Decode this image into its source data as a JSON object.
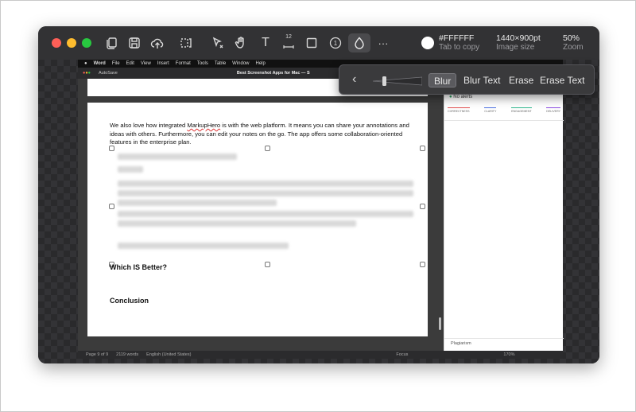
{
  "toolbar": {
    "color_hex": "#FFFFFF",
    "color_hint": "Tab to copy",
    "image_size_value": "1440×900pt",
    "image_size_label": "Image size",
    "zoom_value": "50%",
    "zoom_label": "Zoom",
    "more_label": "···",
    "text_tool": "T",
    "step_tool": "1",
    "size_tool_label": "12"
  },
  "colors": {
    "light_close": "#fe5f57",
    "light_minimize": "#febc2e",
    "light_zoom": "#28c840"
  },
  "blur_popup": {
    "options": [
      "Blur",
      "Blur Text",
      "Erase",
      "Erase Text"
    ],
    "selected": "Blur"
  },
  "screenshot": {
    "menubar": [
      "Word",
      "File",
      "Edit",
      "View",
      "Insert",
      "Format",
      "Tools",
      "Table",
      "Window",
      "Help"
    ],
    "autosave": "AutoSave",
    "doc_title": "Best Screenshot Apps for Mac — S",
    "paragraph_before": "We also love how integrated ",
    "paragraph_misspelled": "MarkupHero",
    "paragraph_after": " is with the web platform. It means you can share your annotations and ideas with others. Furthermore, you can edit your notes on the go. The app offers some collaboration-oriented features in the enterprise plan.",
    "heading_1": "Which IS Better?",
    "heading_2": "Conclusion",
    "side_panel": {
      "alerts": "No alerts",
      "categories": [
        "CORRECTNESS",
        "CLARITY",
        "ENGAGEMENT",
        "DELIVERY"
      ],
      "plagiarism": "Plagiarism"
    },
    "status": {
      "page": "Page 9 of 9",
      "words": "2119 words",
      "language": "English (United States)",
      "focus": "Focus",
      "zoom": "170%"
    }
  }
}
